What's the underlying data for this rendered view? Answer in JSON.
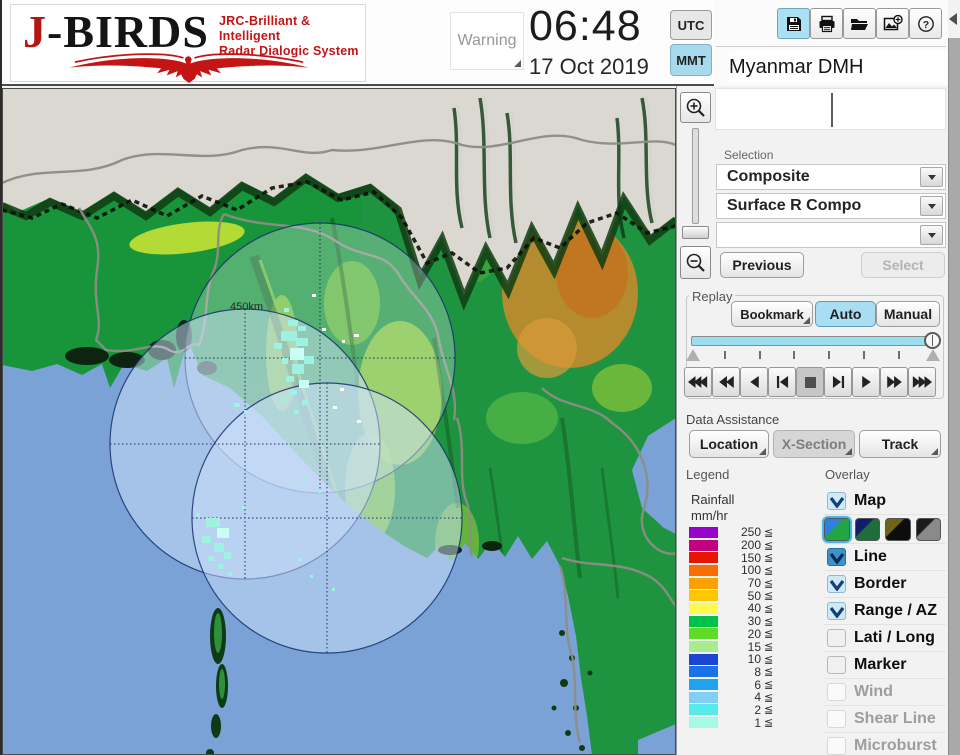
{
  "logo": {
    "brand_j": "J",
    "brand_rest": "-BIRDS",
    "tagline_line1": "JRC-Brilliant & Intelligent",
    "tagline_line2": "Radar  Dialogic  System"
  },
  "clock": {
    "warning_label": "Warning",
    "time": "06:48",
    "date": "17 Oct 2019",
    "tz_utc": "UTC",
    "tz_mmt": "MMT",
    "tz_selected": "MMT"
  },
  "toolbar": {
    "icons": [
      "save-icon",
      "print-icon",
      "open-folder-icon",
      "add-image-icon",
      "help-icon"
    ],
    "active_icon": "save-icon"
  },
  "sidebar": {
    "title": "Myanmar DMH",
    "selection_label": "Selection",
    "combo1": "Composite",
    "combo2": "Surface R Compo",
    "combo3": "",
    "previous_label": "Previous",
    "select_label": "Select"
  },
  "replay": {
    "label": "Replay",
    "bookmark_label": "Bookmark",
    "auto_label": "Auto",
    "manual_label": "Manual",
    "mode_selected": "Auto",
    "playback": [
      "rewind-fast",
      "rewind",
      "play-reverse",
      "step-back",
      "stop",
      "step-forward",
      "play",
      "forward",
      "forward-fast"
    ],
    "playback_pressed": "stop"
  },
  "data_assistance": {
    "label": "Data Assistance",
    "location_label": "Location",
    "xsection_label": "X-Section",
    "track_label": "Track"
  },
  "legend": {
    "title": "Legend",
    "unit_line1": "Rainfall",
    "unit_line2": "mm/hr",
    "le_symbol": "≦",
    "rows": [
      {
        "value": "250",
        "color": "#9702c8"
      },
      {
        "value": "200",
        "color": "#c4007e"
      },
      {
        "value": "150",
        "color": "#e81600"
      },
      {
        "value": "100",
        "color": "#f86e00"
      },
      {
        "value": "70",
        "color": "#fba100"
      },
      {
        "value": "50",
        "color": "#fdc700"
      },
      {
        "value": "40",
        "color": "#fdf94d"
      },
      {
        "value": "30",
        "color": "#00c24a"
      },
      {
        "value": "20",
        "color": "#5fdc25"
      },
      {
        "value": "15",
        "color": "#aaeb8e"
      },
      {
        "value": "10",
        "color": "#1b46d4"
      },
      {
        "value": "8",
        "color": "#1b71e8"
      },
      {
        "value": "6",
        "color": "#21a2ee"
      },
      {
        "value": "4",
        "color": "#7fd0f2"
      },
      {
        "value": "2",
        "color": "#59e9ea"
      },
      {
        "value": "1",
        "color": "#a8f8e8"
      }
    ]
  },
  "overlay": {
    "title": "Overlay",
    "items": [
      {
        "label": "Map",
        "state": "checked"
      },
      {
        "label": "Line",
        "state": "checked-strong"
      },
      {
        "label": "Border",
        "state": "checked"
      },
      {
        "label": "Range / AZ",
        "state": "checked"
      },
      {
        "label": "Lati / Long",
        "state": "unchecked"
      },
      {
        "label": "Marker",
        "state": "unchecked"
      },
      {
        "label": "Wind",
        "state": "disabled"
      },
      {
        "label": "Shear Line",
        "state": "disabled"
      },
      {
        "label": "Microburst",
        "state": "disabled"
      }
    ],
    "map_styles": [
      {
        "top": "#2f7fe0",
        "bottom": "#22a644",
        "selected": true
      },
      {
        "top": "#101c6e",
        "bottom": "#1e6e3c",
        "selected": false
      },
      {
        "top": "#6e6414",
        "bottom": "#0d0d0d",
        "selected": false
      },
      {
        "top": "#1a1a1a",
        "bottom": "#8a8a8a",
        "selected": false
      }
    ]
  },
  "map": {
    "range_ring_label": "450km",
    "sea_color": "#7aa2d6",
    "radar_tint_color": "#cfe2fb",
    "land_color": "#1f9440",
    "plateau_color": "#dbd8d1",
    "rain_color": "#9ff2e2"
  }
}
